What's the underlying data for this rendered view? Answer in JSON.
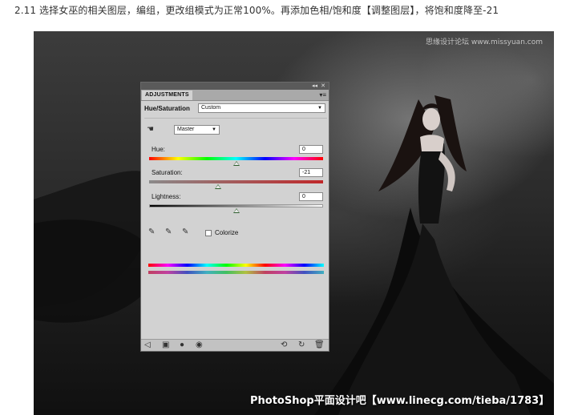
{
  "caption": "2.11 选择女巫的相关图层，编组，更改组模式为正常100%。再添加色相/饱和度【调整图层】，将饱和度降至-21",
  "watermark": "思缘设计论坛 www.missyuan.com",
  "footer_credit": "PhotoShop平面设计吧【www.linecg.com/tieba/1783】",
  "panel": {
    "tab_label": "ADJUSTMENTS",
    "title": "Hue/Saturation",
    "preset_value": "Custom",
    "channel_value": "Master",
    "hue": {
      "label": "Hue:",
      "value": "0",
      "level": 0
    },
    "saturation": {
      "label": "Saturation:",
      "value": "-21",
      "level": -21
    },
    "lightness": {
      "label": "Lightness:",
      "value": "0",
      "level": 0
    },
    "colorize_label": "Colorize",
    "colorize_checked": false
  },
  "colors": {
    "panel_bg": "#d2d2d2",
    "saturation_red": "#c0282a"
  }
}
